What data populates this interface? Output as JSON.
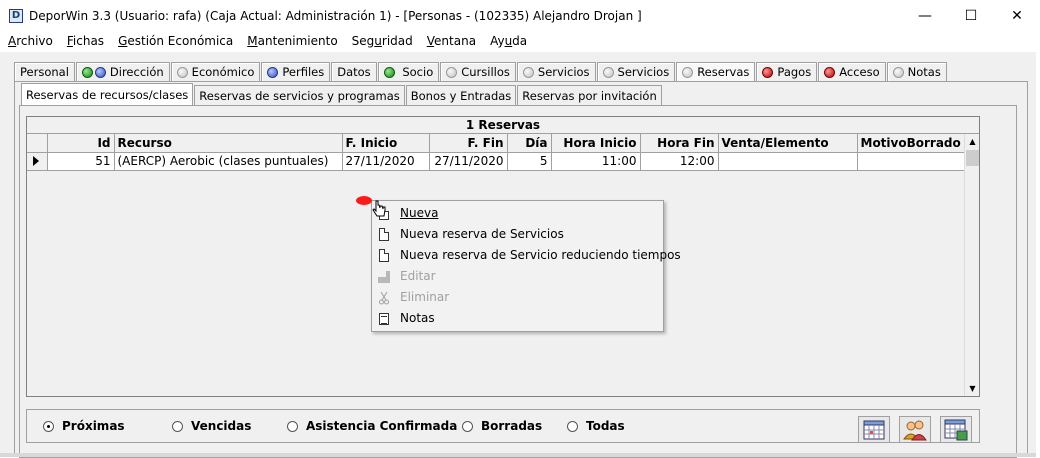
{
  "window": {
    "app_icon_letter": "D",
    "title": "DeporWin 3.3  (Usuario: rafa)  (Caja Actual: Administración 1) - [Personas - (102335) Alejandro Drojan ]",
    "minimize": "—",
    "maximize": "☐",
    "close": "✕"
  },
  "menu": [
    {
      "label": "Archivo",
      "hot": "A",
      "rest": "rchivo"
    },
    {
      "label": "Fichas",
      "hot": "F",
      "rest": "ichas"
    },
    {
      "label": "Gestión Económica",
      "hot": "G",
      "rest": "estión Económica"
    },
    {
      "label": "Mantenimiento",
      "hot": "M",
      "rest": "antenimiento"
    },
    {
      "label": "Seguridad",
      "pre": "Seg",
      "hot": "u",
      "rest": "ridad"
    },
    {
      "label": "Ventana",
      "hot": "V",
      "rest": "entana"
    },
    {
      "label": "Ayuda",
      "pre": "Ay",
      "hot": "u",
      "rest": "da"
    }
  ],
  "main_tabs": [
    {
      "label": "Personal"
    },
    {
      "label": "Dirección"
    },
    {
      "label": "Económico"
    },
    {
      "label": "Perfiles"
    },
    {
      "label": "Datos"
    },
    {
      "label": "Socio"
    },
    {
      "label": "Cursillos"
    },
    {
      "label": "Servicios"
    },
    {
      "label": "Servicios"
    },
    {
      "label": "Reservas"
    },
    {
      "label": "Pagos"
    },
    {
      "label": "Acceso"
    },
    {
      "label": "Notas"
    }
  ],
  "sub_tabs": [
    {
      "label": "Reservas de recursos/clases"
    },
    {
      "label": "Reservas de servicios y programas"
    },
    {
      "label": "Bonos y Entradas"
    },
    {
      "label": "Reservas por invitación"
    }
  ],
  "grid": {
    "caption": "1 Reservas",
    "columns": [
      "Id",
      "Recurso",
      "F. Inicio",
      "F. Fin",
      "Día",
      "Hora Inicio",
      "Hora Fin",
      "Venta/Elemento",
      "MotivoBorrado"
    ],
    "rows": [
      [
        "51",
        "(AERCP) Aerobic (clases puntuales)",
        "27/11/2020",
        "27/11/2020",
        "5",
        "11:00",
        "12:00",
        "",
        ""
      ]
    ]
  },
  "context_menu": {
    "items": [
      {
        "label": "Nueva",
        "icon": "new-document-icon",
        "enabled": true
      },
      {
        "label": "Nueva reserva de Servicios",
        "icon": "document-icon",
        "enabled": true
      },
      {
        "label": "Nueva reserva de Servicio reduciendo tiempos",
        "icon": "document-icon",
        "enabled": true
      },
      {
        "label": "Editar",
        "icon": "edit-icon",
        "enabled": false
      },
      {
        "label": "Eliminar",
        "icon": "scissors-icon",
        "enabled": false
      },
      {
        "label": "Notas",
        "icon": "notes-icon",
        "enabled": true
      }
    ]
  },
  "filters": {
    "options": [
      "Próximas",
      "Vencidas",
      "Asistencia Confirmada",
      "Borradas",
      "Todas"
    ],
    "selected": "Próximas"
  },
  "toolbar_buttons": [
    "calendar-grid-icon",
    "people-icon",
    "schedule-grid-icon"
  ],
  "colors": {
    "accent_red": "#ff1a1a",
    "status_green": "#0a8a0a",
    "status_blue": "#3050c0"
  }
}
